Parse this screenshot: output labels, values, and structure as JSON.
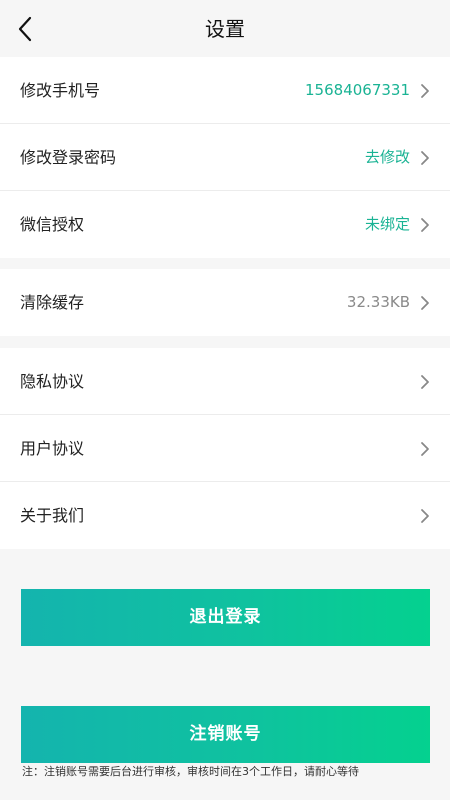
{
  "header": {
    "title": "设置"
  },
  "account_group": {
    "items": [
      {
        "label": "修改手机号",
        "value": "15684067331"
      },
      {
        "label": "修改登录密码",
        "value": "去修改"
      },
      {
        "label": "微信授权",
        "value": "未绑定"
      }
    ]
  },
  "cache_group": {
    "label": "清除缓存",
    "value": "32.33KB"
  },
  "info_group": {
    "items": [
      {
        "label": "隐私协议"
      },
      {
        "label": "用户协议"
      },
      {
        "label": "关于我们"
      }
    ]
  },
  "buttons": {
    "logout": "退出登录",
    "delete_account": "注销账号"
  },
  "note": "注：注销账号需要后台进行审核，审核时间在3个工作日，请耐心等待",
  "colors": {
    "accent": "#1ab394",
    "gradient_start": "#14b4ae",
    "gradient_end": "#04d18f",
    "background": "#f6f6f6"
  },
  "icons": {
    "back": "chevron-left-icon",
    "row_arrow": "chevron-right-icon"
  }
}
